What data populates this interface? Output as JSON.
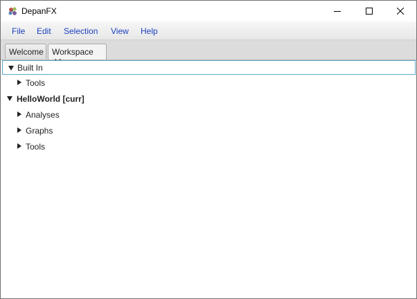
{
  "window": {
    "title": "DepanFX",
    "app_icon": "depanfx-app-icon",
    "controls": [
      "minimize-icon",
      "maximize-icon",
      "close-icon"
    ]
  },
  "menubar": {
    "items": [
      "File",
      "Edit",
      "Selection",
      "View",
      "Help"
    ],
    "color": "#1a3fbf"
  },
  "tabs": [
    {
      "label": "Welcome",
      "closable": false,
      "active": false
    },
    {
      "label": "Workspace",
      "closable": true,
      "active": true,
      "close_icon": "close-icon"
    }
  ],
  "tree": {
    "selection_color": "#5fa7c9",
    "nodes": [
      {
        "label": "Built In",
        "expanded": true,
        "bold": false,
        "level": 0,
        "selected": true
      },
      {
        "label": "Tools",
        "expanded": false,
        "bold": false,
        "level": 1
      },
      {
        "label": "HelloWorld [curr]",
        "expanded": true,
        "bold": true,
        "level": 0
      },
      {
        "label": "Analyses",
        "expanded": false,
        "bold": false,
        "level": 1
      },
      {
        "label": "Graphs",
        "expanded": false,
        "bold": false,
        "level": 1
      },
      {
        "label": "Tools",
        "expanded": false,
        "bold": false,
        "level": 1
      }
    ]
  }
}
